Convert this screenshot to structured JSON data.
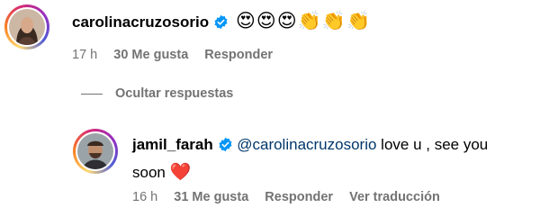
{
  "comment": {
    "username": "carolinacruzosorio",
    "emojis": [
      "😍",
      "😍",
      "😍",
      "👏",
      "👏",
      "👏"
    ],
    "time": "17 h",
    "likes": "30 Me gusta",
    "reply_label": "Responder"
  },
  "hide_replies_label": "Ocultar respuestas",
  "reply": {
    "username": "jamil_farah",
    "mention": "@carolinacruzosorio",
    "text_line1": " love u , see you",
    "text_line2": "soon",
    "heart": "❤️",
    "time": "16 h",
    "likes": "31 Me gusta",
    "reply_label": "Responder",
    "translate_label": "Ver traducción"
  },
  "colors": {
    "verified": "#0095f6",
    "meta": "#737373",
    "mention": "#00376b"
  }
}
